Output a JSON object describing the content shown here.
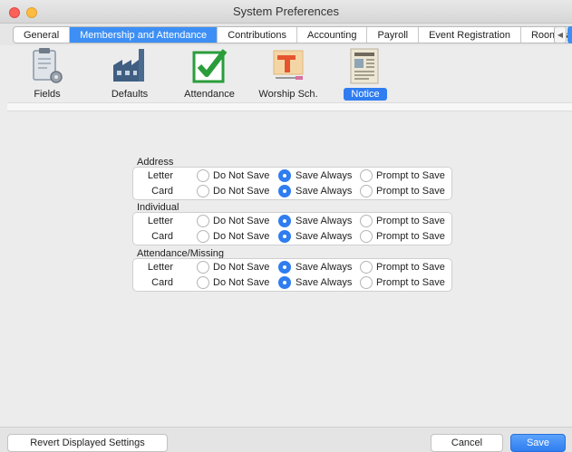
{
  "window": {
    "title": "System Preferences"
  },
  "tabs": [
    {
      "label": "General"
    },
    {
      "label": "Membership and Attendance",
      "active": true
    },
    {
      "label": "Contributions"
    },
    {
      "label": "Accounting"
    },
    {
      "label": "Payroll"
    },
    {
      "label": "Event Registration"
    },
    {
      "label": "Roommate"
    }
  ],
  "toolbar": {
    "items": [
      {
        "label": "Fields",
        "icon": "clipboard-gear-icon"
      },
      {
        "label": "Defaults",
        "icon": "factory-icon"
      },
      {
        "label": "Attendance",
        "icon": "checkmark-box-icon"
      },
      {
        "label": "Worship Sch.",
        "icon": "presentation-board-icon"
      },
      {
        "label": "Notice",
        "icon": "newspaper-icon",
        "selected": true
      }
    ]
  },
  "options": {
    "do_not_save": "Do Not Save",
    "save_always": "Save Always",
    "prompt": "Prompt to Save"
  },
  "groups": [
    {
      "title": "Address",
      "rows": [
        {
          "label": "Letter",
          "selected": "save_always"
        },
        {
          "label": "Card",
          "selected": "save_always"
        }
      ]
    },
    {
      "title": "Individual",
      "rows": [
        {
          "label": "Letter",
          "selected": "save_always"
        },
        {
          "label": "Card",
          "selected": "save_always"
        }
      ]
    },
    {
      "title": "Attendance/Missing",
      "rows": [
        {
          "label": "Letter",
          "selected": "save_always"
        },
        {
          "label": "Card",
          "selected": "save_always"
        }
      ]
    }
  ],
  "footer": {
    "revert_label": "Revert Displayed Settings",
    "cancel_label": "Cancel",
    "save_label": "Save"
  },
  "colors": {
    "accent": "#2f7df0",
    "tab_active": "#3d8ff5"
  }
}
